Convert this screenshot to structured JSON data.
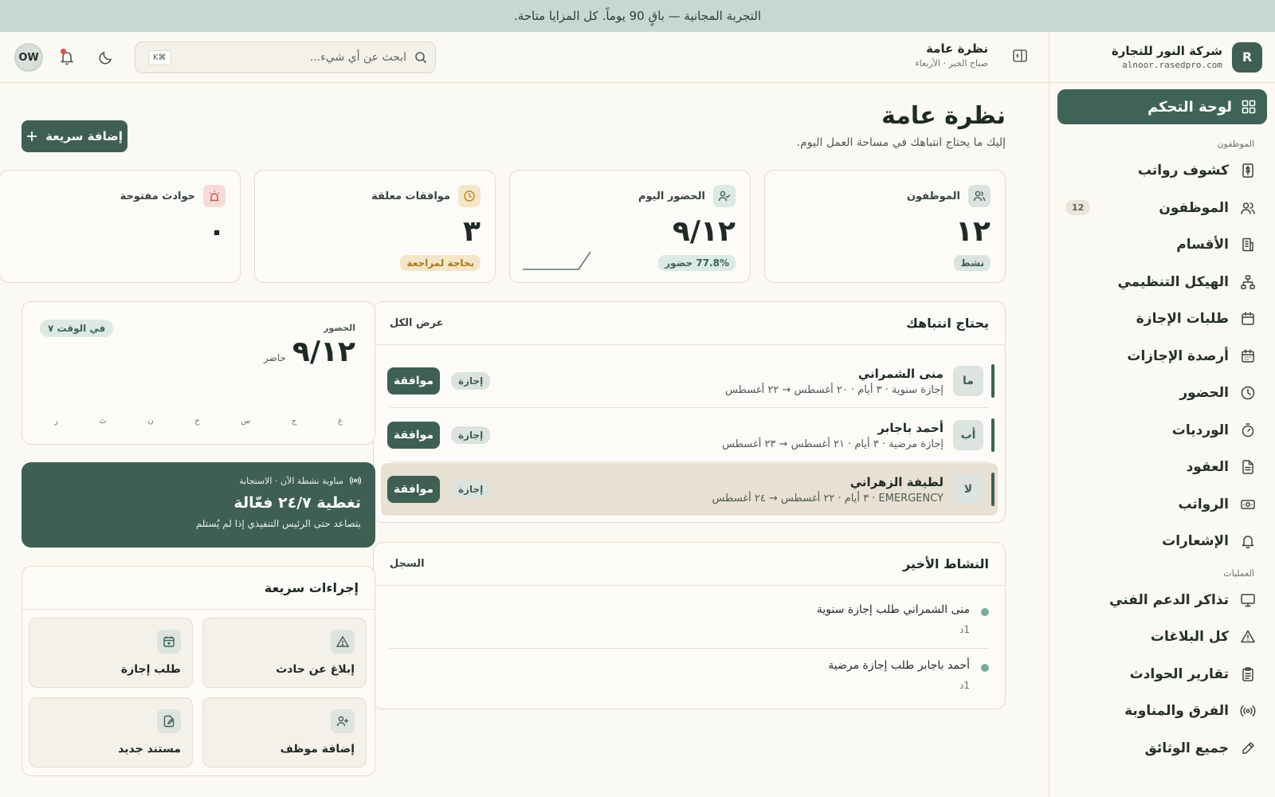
{
  "banner": {
    "text": "التجربة المجانية — باقٍ 90 يوماً. كل المزايا متاحة."
  },
  "brand": {
    "logo_letter": "R",
    "name": "شركة النور للتجارة",
    "domain": "alnoor.rasedpro.com"
  },
  "sidebar": {
    "active": {
      "label": "لوحة التحكم",
      "icon": "grid-icon"
    },
    "sections": [
      {
        "title": "الموظفون",
        "items": [
          {
            "label": "كشوف رواتب",
            "icon": "dollar-doc-icon",
            "badge": ""
          },
          {
            "label": "الموظفون",
            "icon": "users-icon",
            "badge": "12"
          },
          {
            "label": "الأقسام",
            "icon": "building-icon",
            "badge": ""
          },
          {
            "label": "الهيكل التنظيمي",
            "icon": "org-chart-icon",
            "badge": ""
          },
          {
            "label": "طلبات الإجازة",
            "icon": "calendar-icon",
            "badge": ""
          },
          {
            "label": "أرصدة الإجازات",
            "icon": "calendar-grid-icon",
            "badge": ""
          },
          {
            "label": "الحضور",
            "icon": "clock-icon",
            "badge": ""
          },
          {
            "label": "الورديات",
            "icon": "timer-icon",
            "badge": ""
          },
          {
            "label": "العقود",
            "icon": "document-icon",
            "badge": ""
          },
          {
            "label": "الرواتب",
            "icon": "banknote-icon",
            "badge": ""
          },
          {
            "label": "الإشعارات",
            "icon": "bell-icon",
            "badge": ""
          }
        ]
      },
      {
        "title": "العمليات",
        "items": [
          {
            "label": "تذاكر الدعم الفني",
            "icon": "monitor-icon",
            "badge": ""
          },
          {
            "label": "كل البلاغات",
            "icon": "warning-icon",
            "badge": ""
          },
          {
            "label": "تقارير الحوادث",
            "icon": "clipboard-icon",
            "badge": ""
          },
          {
            "label": "الفرق والمناوبة",
            "icon": "radio-icon",
            "badge": ""
          },
          {
            "label": "جميع الوثائق",
            "icon": "pen-icon",
            "badge": ""
          }
        ]
      }
    ]
  },
  "header": {
    "title": "نظرة عامة",
    "subtitle": "صباح الخير · الأربعاء",
    "search_placeholder": "ابحث عن أي شيء...",
    "shortcut": "K⌘",
    "avatar_initials": "OW"
  },
  "page": {
    "title": "نظرة عامة",
    "subtitle": "إليك ما يحتاج انتباهك في مساحة العمل اليوم.",
    "quick_add_label": "إضافة سريعة"
  },
  "stats": [
    {
      "label": "الموظفون",
      "value": "١٢",
      "pill": "نشط",
      "icon": "users-icon",
      "color": "#dbe3df"
    },
    {
      "label": "الحضور اليوم",
      "value": "٩/١٢",
      "pill": "77.8% حضور",
      "icon": "user-check-icon",
      "color": "#dbeae2"
    },
    {
      "label": "موافقات معلقة",
      "value": "٣",
      "pill": "بحاجة لمراجعة",
      "icon": "clock-icon",
      "color": "#f4e6c8"
    },
    {
      "label": "حوادث مفتوحة",
      "value": "٠",
      "pill": "",
      "icon": "siren-icon",
      "color": "#f5dcd8"
    }
  ],
  "attention": {
    "title": "يحتاج انتباهك",
    "view_all": "عرض الكل",
    "items": [
      {
        "initials": "ما",
        "name": "منى الشمراني",
        "detail": "إجازة سنوية · ٣ أيام · ٢٠ أغسطس → ٢٢ أغسطس",
        "tag": "إجازة",
        "action": "موافقة"
      },
      {
        "initials": "أب",
        "name": "أحمد باجابر",
        "detail": "إجازة مرضية · ٣ أيام · ٢١ أغسطس → ٢٣ أغسطس",
        "tag": "إجازة",
        "action": "موافقة"
      },
      {
        "initials": "لا",
        "name": "لطيفة الزهراني",
        "detail": "EMERGENCY · ٣ أيام · ٢٢ أغسطس → ٢٤ أغسطس",
        "tag": "إجازة",
        "action": "موافقة"
      }
    ]
  },
  "activity": {
    "title": "النشاط الأخير",
    "log_link": "السجل",
    "items": [
      {
        "text": "منى الشمراني طلب إجازة سنوية",
        "time": "1د"
      },
      {
        "text": "أحمد باجابر طلب إجازة مرضية",
        "time": "1د"
      }
    ]
  },
  "attendance_card": {
    "label": "الحضور",
    "value": "٩/١٢",
    "unit": "حاضر",
    "badge": "في الوقت ٧",
    "days": [
      "غ",
      "ج",
      "س",
      "ح",
      "ن",
      "ث",
      "ر"
    ]
  },
  "coverage": {
    "top": "مناوبة نشطة الآن · الاستجابة",
    "title": "تغطية ٢٤/٧ فعّالة",
    "subtitle": "يتصاعد حتى الرئيس التنفيذي إذا لم يُستلم"
  },
  "quick_actions": {
    "title": "إجراءات سريعة",
    "items": [
      {
        "label": "إبلاغ عن حادث",
        "icon": "warning-icon"
      },
      {
        "label": "طلب إجازة",
        "icon": "calendar-plus-icon"
      },
      {
        "label": "إضافة موظف",
        "icon": "user-plus-icon"
      },
      {
        "label": "مستند جديد",
        "icon": "file-edit-icon"
      }
    ]
  }
}
